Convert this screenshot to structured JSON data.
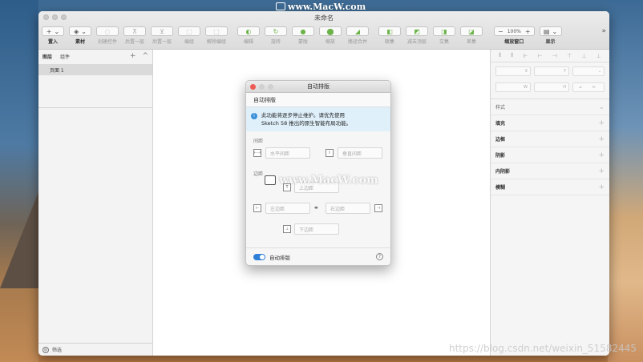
{
  "watermark": {
    "top": "www.MacW.com",
    "middle": "www.MacW.com",
    "bottom": "https://blog.csdn.net/weixin_51582445"
  },
  "window": {
    "title": "未命名"
  },
  "toolbar": {
    "insert": {
      "icon": "+",
      "label": "置入"
    },
    "assets": {
      "icon": "◈",
      "label": "素材"
    },
    "create_component": {
      "icon": "◌",
      "label": "创建控件"
    },
    "move_forward": {
      "icon": "⊼",
      "label": "后置一层"
    },
    "move_backward": {
      "icon": "⊻",
      "label": "后置一层"
    },
    "group": {
      "icon": "⬚",
      "label": "编组"
    },
    "ungroup": {
      "icon": "⬚",
      "label": "解除编组"
    },
    "edit": {
      "icon": "◐",
      "label": "编辑"
    },
    "rotate": {
      "icon": "↻",
      "label": "旋转"
    },
    "mask": {
      "icon": "●",
      "label": "蒙版"
    },
    "scale": {
      "icon": "⬤",
      "label": "缩放"
    },
    "flatten": {
      "icon": "◢",
      "label": "路径合并"
    },
    "union": {
      "icon": "◧",
      "label": "联集"
    },
    "subtract": {
      "icon": "◩",
      "label": "减去顶层"
    },
    "intersect": {
      "icon": "◨",
      "label": "交集"
    },
    "difference": {
      "icon": "◪",
      "label": "差集"
    },
    "zoom": {
      "minus": "−",
      "value": "100%",
      "plus": "+",
      "label": "缩放窗口"
    },
    "view": {
      "icon": "▤",
      "label": "显示"
    },
    "more": "»"
  },
  "left_panel": {
    "tabs": [
      "图层",
      "组件"
    ],
    "add": "+",
    "collapse": "^",
    "pages": [
      "页面 1"
    ],
    "filter_label": "筛选"
  },
  "right_panel": {
    "align_icons": [
      "⫴",
      "⫴",
      "⊩",
      "⊢",
      "⊣",
      "⊤",
      "⊥",
      "⊥"
    ],
    "fields": {
      "x": "X",
      "y": "Y",
      "w": "W",
      "h": "H"
    },
    "style_header": "样式",
    "sections": [
      "填充",
      "边框",
      "阴影",
      "内阴影",
      "模糊"
    ]
  },
  "dialog": {
    "title": "自动排版",
    "heading": "自动排版",
    "info_line1": "此功能将逐步停止维护。请优先使用",
    "info_line2": "Sketch 58 推出的原生智能布局功能。",
    "spacing_label": "间距",
    "horizontal_spacing_placeholder": "水平间距",
    "vertical_spacing_placeholder": "垂直间距",
    "padding_label": "边距",
    "top_padding_placeholder": "上边距",
    "left_padding_placeholder": "左边距",
    "right_padding_placeholder": "右边距",
    "bottom_padding_placeholder": "下边距",
    "toggle_label": "自动排版",
    "help": "?"
  }
}
